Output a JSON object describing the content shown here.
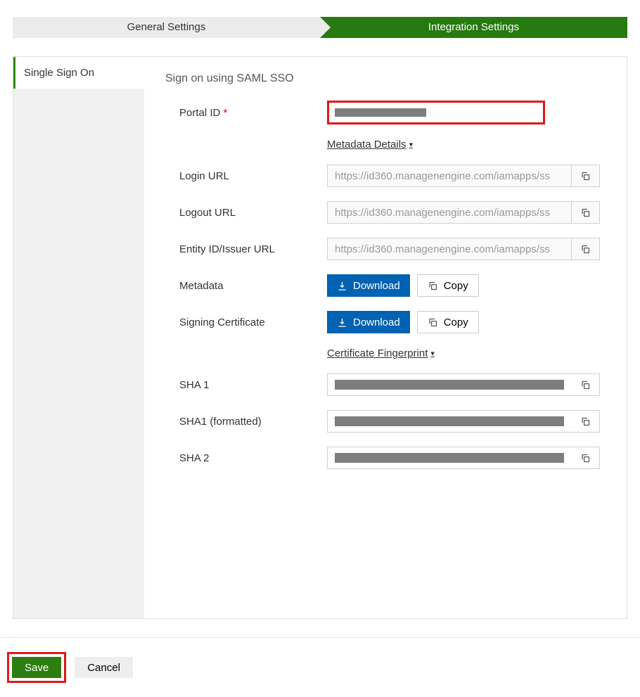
{
  "tabs": {
    "general": "General Settings",
    "integration": "Integration Settings"
  },
  "sidebar": {
    "item": "Single Sign On"
  },
  "main": {
    "title": "Sign on using SAML SSO",
    "labels": {
      "portal_id": "Portal ID",
      "login_url": "Login URL",
      "logout_url": "Logout URL",
      "entity_url": "Entity ID/Issuer URL",
      "metadata": "Metadata",
      "signing_cert": "Signing Certificate",
      "sha1": "SHA 1",
      "sha1_formatted": "SHA1 (formatted)",
      "sha2": "SHA 2"
    },
    "links": {
      "metadata_details": "Metadata Details",
      "cert_fingerprint": "Certificate Fingerprint"
    },
    "values": {
      "login_url": "https://id360.managenengine.com/iamapps/ss",
      "logout_url": "https://id360.managenengine.com/iamapps/ss",
      "entity_url": "https://id360.managenengine.com/iamapps/ss"
    },
    "buttons": {
      "download": "Download",
      "copy": "Copy"
    }
  },
  "footer": {
    "save": "Save",
    "cancel": "Cancel"
  }
}
